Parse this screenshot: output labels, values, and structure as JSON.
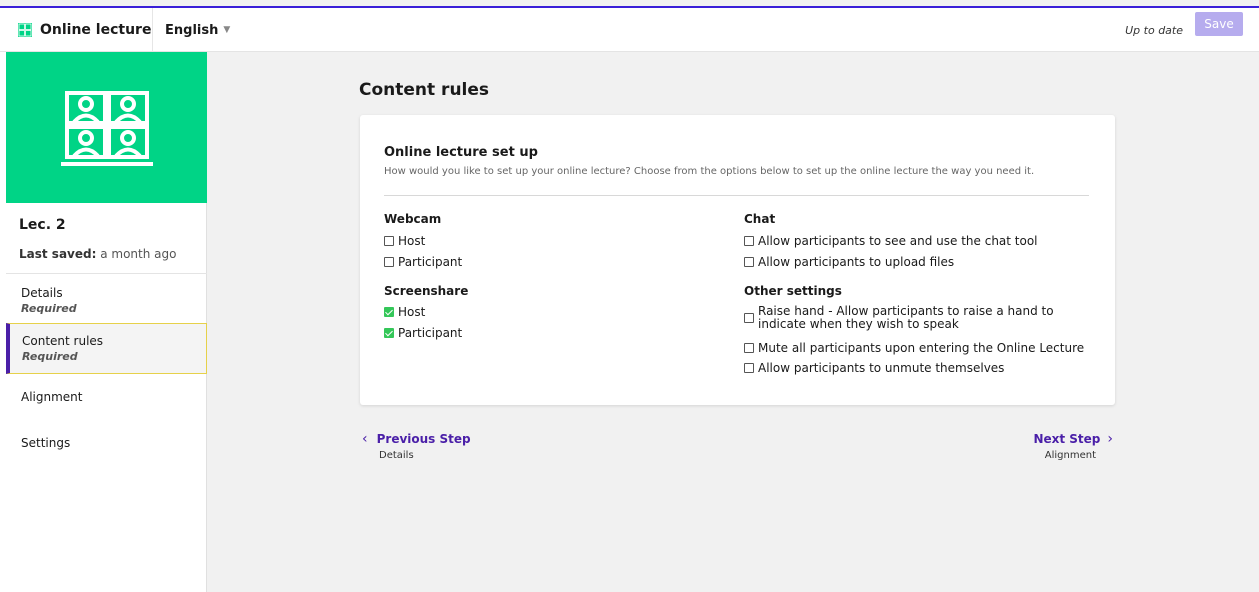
{
  "header": {
    "app_name": "Online lecture",
    "language": "English",
    "status": "Up to date",
    "save_label": "Save",
    "accent_color": "#3a1fd8"
  },
  "sidebar": {
    "thumbnail_color": "#00d486",
    "lecture_title": "Lec. 2",
    "last_saved_label": "Last saved:",
    "last_saved_value": "a month ago",
    "items": [
      {
        "label": "Details",
        "sub": "Required",
        "active": false
      },
      {
        "label": "Content rules",
        "sub": "Required",
        "active": true
      },
      {
        "label": "Alignment",
        "sub": "",
        "active": false
      },
      {
        "label": "Settings",
        "sub": "",
        "active": false
      }
    ]
  },
  "main": {
    "title": "Content rules",
    "card": {
      "title": "Online lecture set up",
      "description": "How would you like to set up your online lecture? Choose from the options below to set up the online lecture the way you need it.",
      "webcam": {
        "title": "Webcam",
        "options": [
          {
            "label": "Host",
            "checked": false
          },
          {
            "label": "Participant",
            "checked": false
          }
        ]
      },
      "screenshare": {
        "title": "Screenshare",
        "options": [
          {
            "label": "Host",
            "checked": true
          },
          {
            "label": "Participant",
            "checked": true
          }
        ]
      },
      "chat": {
        "title": "Chat",
        "options": [
          {
            "label": "Allow participants to see and use the chat tool",
            "checked": false
          },
          {
            "label": "Allow participants to upload files",
            "checked": false
          }
        ]
      },
      "other": {
        "title": "Other settings",
        "options": [
          {
            "label": "Raise hand - Allow participants to raise a hand to indicate when they wish to speak",
            "checked": false
          },
          {
            "label": "Mute all participants upon entering the Online Lecture",
            "checked": false
          },
          {
            "label": "Allow participants to unmute themselves",
            "checked": false
          }
        ]
      }
    },
    "prev_step": {
      "label": "Previous Step",
      "sub": "Details"
    },
    "next_step": {
      "label": "Next Step",
      "sub": "Alignment"
    }
  }
}
